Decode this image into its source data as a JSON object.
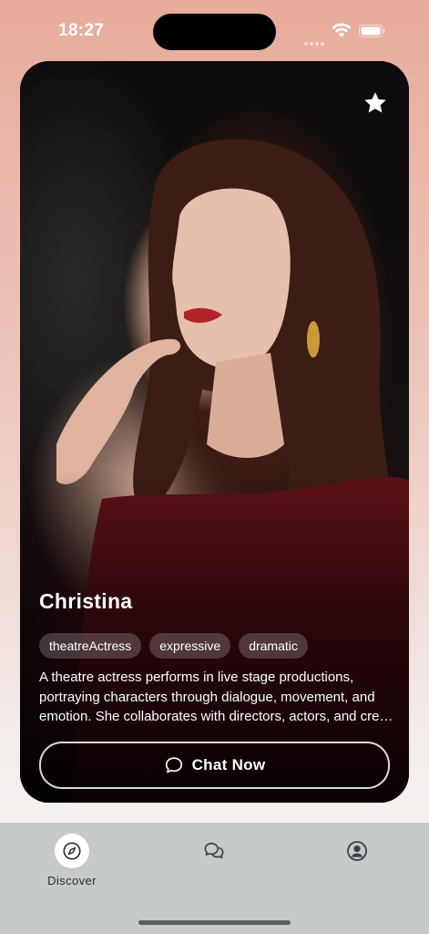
{
  "status_bar": {
    "time": "18:27"
  },
  "card": {
    "name": "Christina",
    "tags": [
      "theatreActress",
      "expressive",
      "dramatic"
    ],
    "description": "A theatre actress performs in live stage productions, portraying characters through dialogue, movement, and emotion. She collaborates with directors, actors, and crew to bring stories to life on stage.",
    "chat_button_label": "Chat Now",
    "favorite_icon": "star-icon"
  },
  "tab_bar": {
    "tabs": [
      {
        "label": "Discover",
        "icon": "compass-icon",
        "active": true
      },
      {
        "label": "",
        "icon": "chat-bubbles-icon",
        "active": false
      },
      {
        "label": "",
        "icon": "profile-icon",
        "active": false
      }
    ]
  },
  "colors": {
    "background_top": "#e7ab9b",
    "background_bottom": "#f6f3f2",
    "tab_bar": "#c6cacb",
    "text_light": "#ffffff",
    "text_dark": "#2a2d33"
  }
}
